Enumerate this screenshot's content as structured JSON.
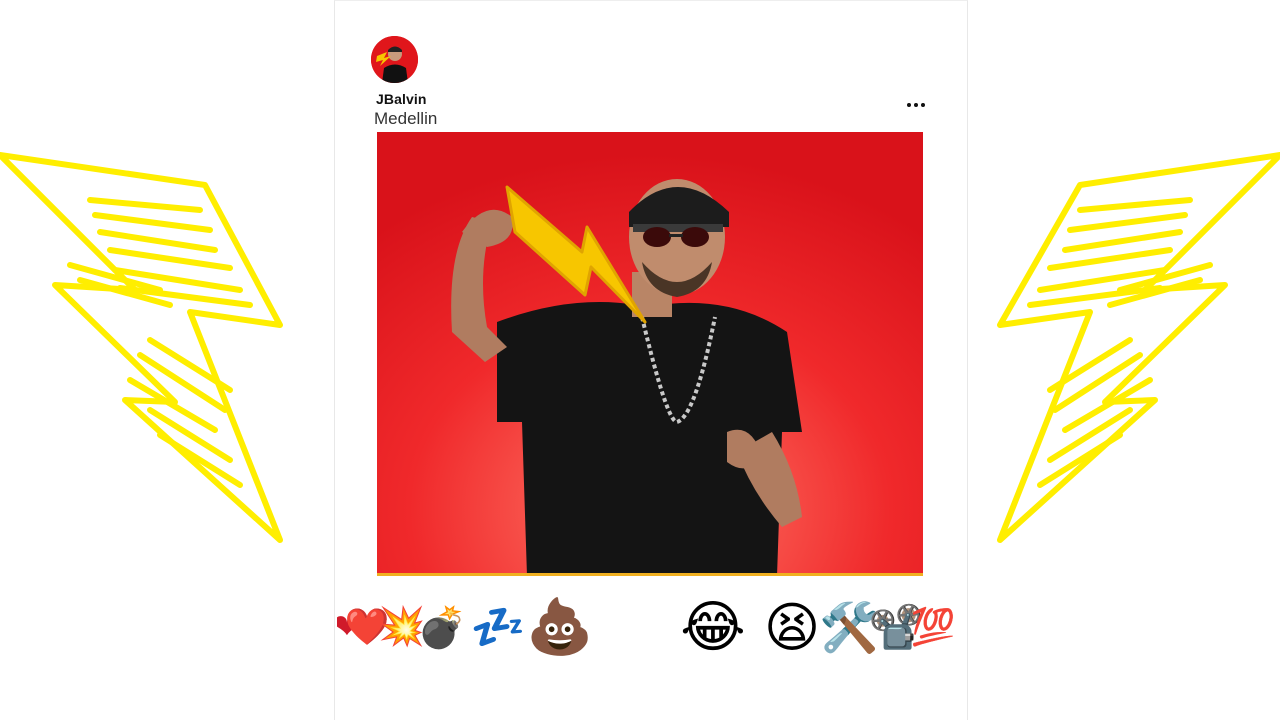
{
  "post": {
    "username": "JBalvin",
    "location": "Medellin",
    "more_label": "More options"
  },
  "reactions": [
    {
      "name": "red-heart",
      "emoji": "❤️"
    },
    {
      "name": "collision",
      "emoji": "💥"
    },
    {
      "name": "bomb",
      "emoji": "💣"
    },
    {
      "name": "zzz",
      "emoji": "💤"
    },
    {
      "name": "pile-of-poo",
      "emoji": "💩"
    },
    {
      "name": "face-with-tears-of-joy",
      "emoji": "😂"
    },
    {
      "name": "tired-face",
      "emoji": "😫"
    },
    {
      "name": "hammer-and-wrench",
      "emoji": "🛠️"
    },
    {
      "name": "film-projector",
      "emoji": "📽️"
    },
    {
      "name": "hundred-points",
      "emoji": "💯"
    }
  ],
  "colors": {
    "accent_yellow": "#ffee00",
    "post_background": "#e0161b",
    "bolt_yellow": "#f7c600"
  }
}
